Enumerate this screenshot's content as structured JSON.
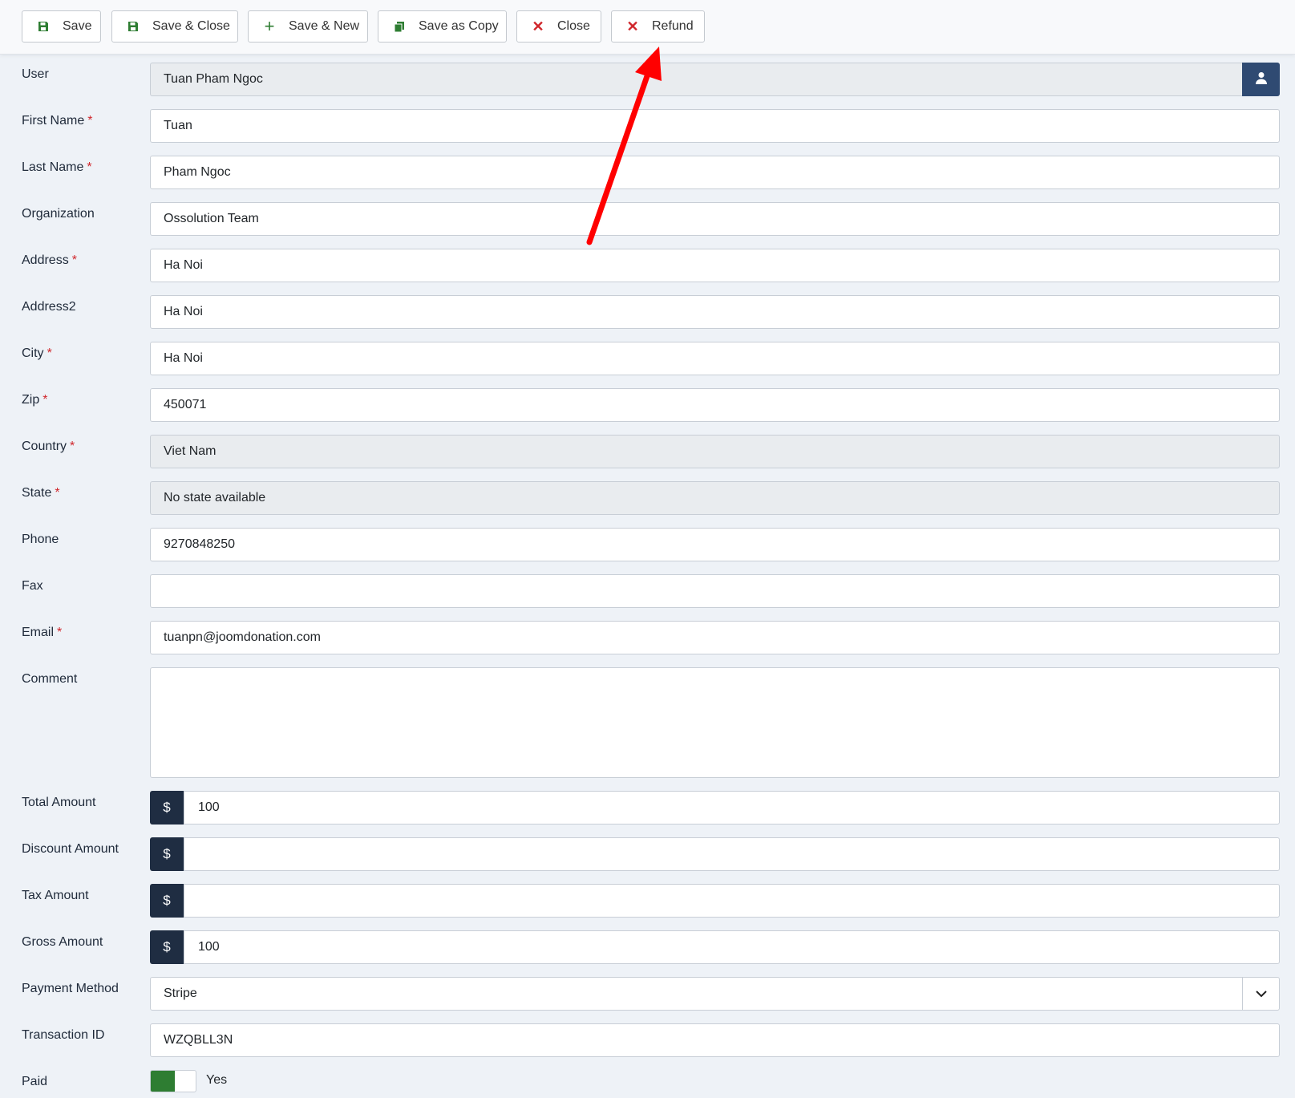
{
  "toolbar": {
    "save": "Save",
    "save_close": "Save & Close",
    "save_new": "Save & New",
    "save_copy": "Save as Copy",
    "close": "Close",
    "refund": "Refund"
  },
  "form": {
    "user": {
      "label": "User",
      "value": "Tuan Pham Ngoc"
    },
    "first_name": {
      "label": "First Name",
      "value": "Tuan",
      "required_mark": "*"
    },
    "last_name": {
      "label": "Last Name",
      "value": "Pham Ngoc",
      "required_mark": "*"
    },
    "organization": {
      "label": "Organization",
      "value": "Ossolution Team"
    },
    "address": {
      "label": "Address",
      "value": "Ha Noi",
      "required_mark": "*"
    },
    "address2": {
      "label": "Address2",
      "value": "Ha Noi"
    },
    "city": {
      "label": "City",
      "value": "Ha Noi",
      "required_mark": "*"
    },
    "zip": {
      "label": "Zip",
      "value": "450071",
      "required_mark": "*"
    },
    "country": {
      "label": "Country",
      "value": "Viet Nam",
      "required_mark": "*"
    },
    "state": {
      "label": "State",
      "value": "No state available",
      "required_mark": "*"
    },
    "phone": {
      "label": "Phone",
      "value": "9270848250"
    },
    "fax": {
      "label": "Fax",
      "value": ""
    },
    "email": {
      "label": "Email",
      "value": "tuanpn@joomdonation.com",
      "required_mark": "*"
    },
    "comment": {
      "label": "Comment",
      "value": ""
    },
    "currency_symbol": "$",
    "total_amount": {
      "label": "Total Amount",
      "value": "100"
    },
    "discount_amount": {
      "label": "Discount Amount",
      "value": ""
    },
    "tax_amount": {
      "label": "Tax Amount",
      "value": ""
    },
    "gross_amount": {
      "label": "Gross Amount",
      "value": "100"
    },
    "payment_method": {
      "label": "Payment Method",
      "value": "Stripe"
    },
    "transaction_id": {
      "label": "Transaction ID",
      "value": "WZQBLL3N"
    },
    "paid": {
      "label": "Paid",
      "value": "Yes"
    }
  },
  "colors": {
    "accent": "#2f4a72",
    "currency_bg": "#1f2d42",
    "toggle_on": "#2e7d32",
    "required": "#d0262b",
    "annotation_arrow": "#ff0000"
  }
}
